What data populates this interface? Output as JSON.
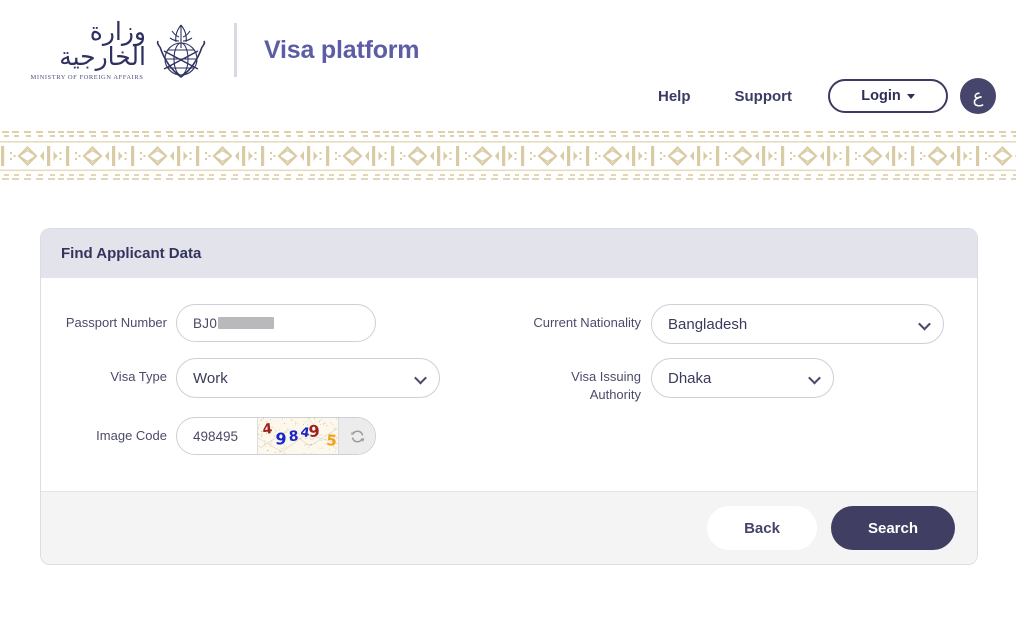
{
  "header": {
    "ministry_arabic": "وزارة الخارجية",
    "ministry_english": "MINISTRY OF FOREIGN AFFAIRS",
    "app_title": "Visa platform",
    "nav": {
      "help": "Help",
      "support": "Support",
      "login": "Login",
      "language_toggle": "ع"
    }
  },
  "card": {
    "title": "Find Applicant Data",
    "fields": {
      "passport_number": {
        "label": "Passport Number",
        "value_visible": "BJ0",
        "redacted": true
      },
      "current_nationality": {
        "label": "Current Nationality",
        "value": "Bangladesh"
      },
      "visa_type": {
        "label": "Visa Type",
        "value": "Work"
      },
      "visa_issuing_authority": {
        "label_line1": "Visa Issuing",
        "label_line2": "Authority",
        "value": "Dhaka"
      },
      "image_code": {
        "label": "Image Code",
        "value": "498495",
        "placeholder": "",
        "captcha_digits": [
          {
            "char": "4",
            "color": "#9e2020"
          },
          {
            "char": "9",
            "color": "#1a25c8"
          },
          {
            "char": "8",
            "color": "#1a25c8"
          },
          {
            "char": "4",
            "color": "#1a25c8"
          },
          {
            "char": "9",
            "color": "#9e2020"
          },
          {
            "char": "5",
            "color": "#f2a114"
          }
        ],
        "refresh_icon": "refresh-icon"
      }
    },
    "footer": {
      "back": "Back",
      "search": "Search"
    }
  },
  "colors": {
    "brand_title": "#5d5da6",
    "navy": "#3b3a63",
    "card_header_bg": "#e3e3ec",
    "primary_button": "#403f63",
    "sadu_pattern": "#d9cba4"
  }
}
